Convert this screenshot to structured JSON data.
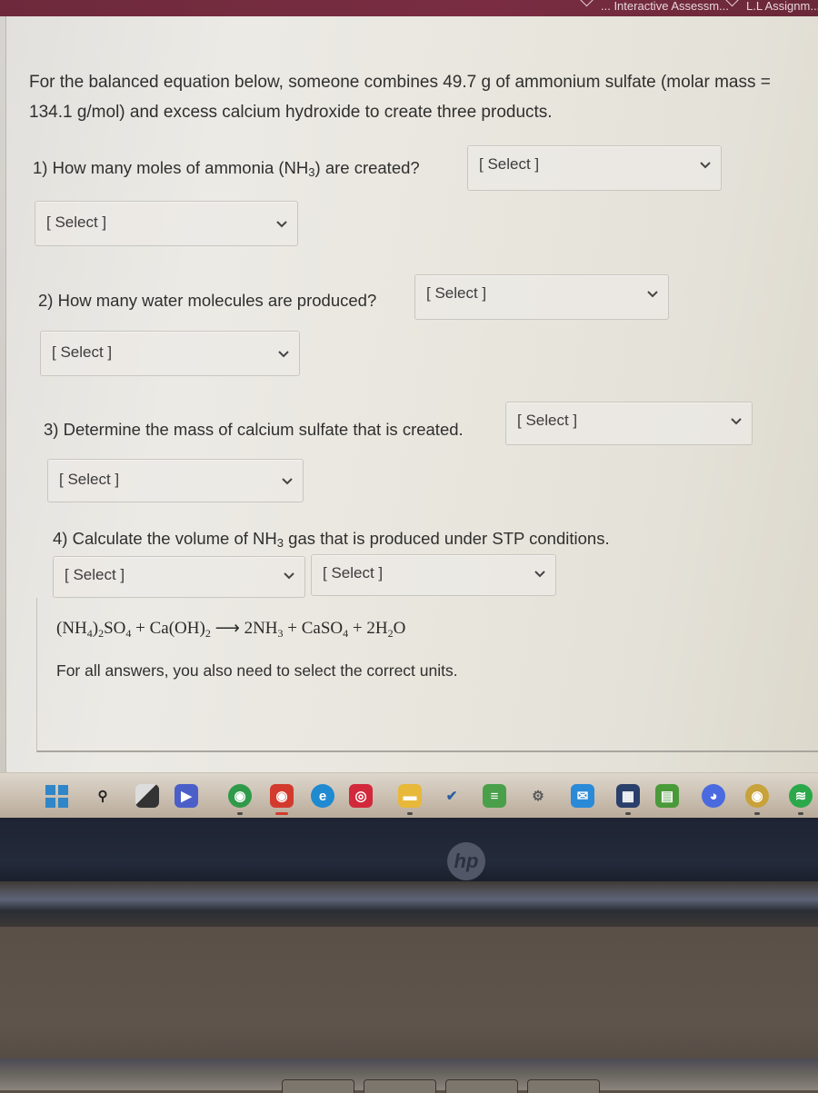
{
  "browser": {
    "top_tabs": [
      {
        "label": "... Interactive Assessm..."
      },
      {
        "label": "L.L Assignm..."
      }
    ]
  },
  "question": {
    "intro": "For the balanced equation below, someone combines 49.7 g of ammonium sulfate (molar mass = 134.1 g/mol) and excess calcium hydroxide to create three products.",
    "parts": [
      {
        "label_before": "1) How many moles of ammonia (NH",
        "label_sub": "3",
        "label_after": ") are created?",
        "value_select": "[ Select ]",
        "unit_select": "[ Select ]"
      },
      {
        "label_before": "2) How many water molecules are produced?",
        "label_sub": "",
        "label_after": "",
        "value_select": "[ Select ]",
        "unit_select": "[ Select ]"
      },
      {
        "label_before": "3) Determine the mass of calcium sulfate that is created.",
        "label_sub": "",
        "label_after": "",
        "value_select": "[ Select ]",
        "unit_select": "[ Select ]"
      },
      {
        "label_before": "4) Calculate the volume of NH",
        "label_sub": "3",
        "label_after": " gas that is produced under STP conditions.",
        "value_select": "[ Select ]",
        "unit_select": "[ Select ]"
      }
    ],
    "equation": {
      "reactant1": "(NH",
      "reactant1_sub1": "4",
      "reactant1_mid": ")",
      "reactant1_sub2": "2",
      "reactant1_end": "SO",
      "reactant1_sub3": "4",
      "plus1": " + ",
      "reactant2": "Ca(OH)",
      "reactant2_sub": "2",
      "arrow": " ⟶ ",
      "product1": "2NH",
      "product1_sub": "3",
      "plus2": " + ",
      "product2": "CaSO",
      "product2_sub": "4",
      "plus3": " + ",
      "product3": "2H",
      "product3_sub": "2",
      "product3_end": "O"
    },
    "note": "For all answers, you also need to select the correct units."
  },
  "taskbar": {
    "icons": [
      {
        "name": "windows-start-icon",
        "glyph": "",
        "color": "#2f86c8"
      },
      {
        "name": "search-icon",
        "glyph": "⚲",
        "color": "transparent"
      },
      {
        "name": "task-view-icon",
        "glyph": "",
        "color": "#3a3a3a"
      },
      {
        "name": "meet-video-icon",
        "glyph": "▶",
        "color": "#4a5fc8"
      },
      {
        "name": "chrome-profile-1-icon",
        "glyph": "◉",
        "color": "#2f9a4a"
      },
      {
        "name": "chrome-profile-2-icon",
        "glyph": "◉",
        "color": "#d23a2e"
      },
      {
        "name": "edge-icon",
        "glyph": "e",
        "color": "#1f8ad0"
      },
      {
        "name": "app-red-icon",
        "glyph": "◎",
        "color": "#d2283c"
      },
      {
        "name": "file-explorer-icon",
        "glyph": "▬",
        "color": "#e8b83a"
      },
      {
        "name": "todo-check-icon",
        "glyph": "✔",
        "color": "transparent"
      },
      {
        "name": "bluestacks-icon",
        "glyph": "≡",
        "color": "#4aa04a"
      },
      {
        "name": "settings-gear-icon",
        "glyph": "⚙",
        "color": "transparent"
      },
      {
        "name": "mail-icon",
        "glyph": "✉",
        "color": "#2a8ad8"
      },
      {
        "name": "microsoft-store-icon",
        "glyph": "▦",
        "color": "#2a3f6a"
      },
      {
        "name": "app-green-icon",
        "glyph": "▤",
        "color": "#4a9a3a"
      },
      {
        "name": "discord-icon",
        "glyph": "◕",
        "color": "#4a6ae0"
      },
      {
        "name": "chrome-profile-3-icon",
        "glyph": "◉",
        "color": "#c8a23a"
      },
      {
        "name": "spotify-icon",
        "glyph": "≋",
        "color": "#2aa84a"
      }
    ]
  },
  "device": {
    "logo": "hp"
  }
}
